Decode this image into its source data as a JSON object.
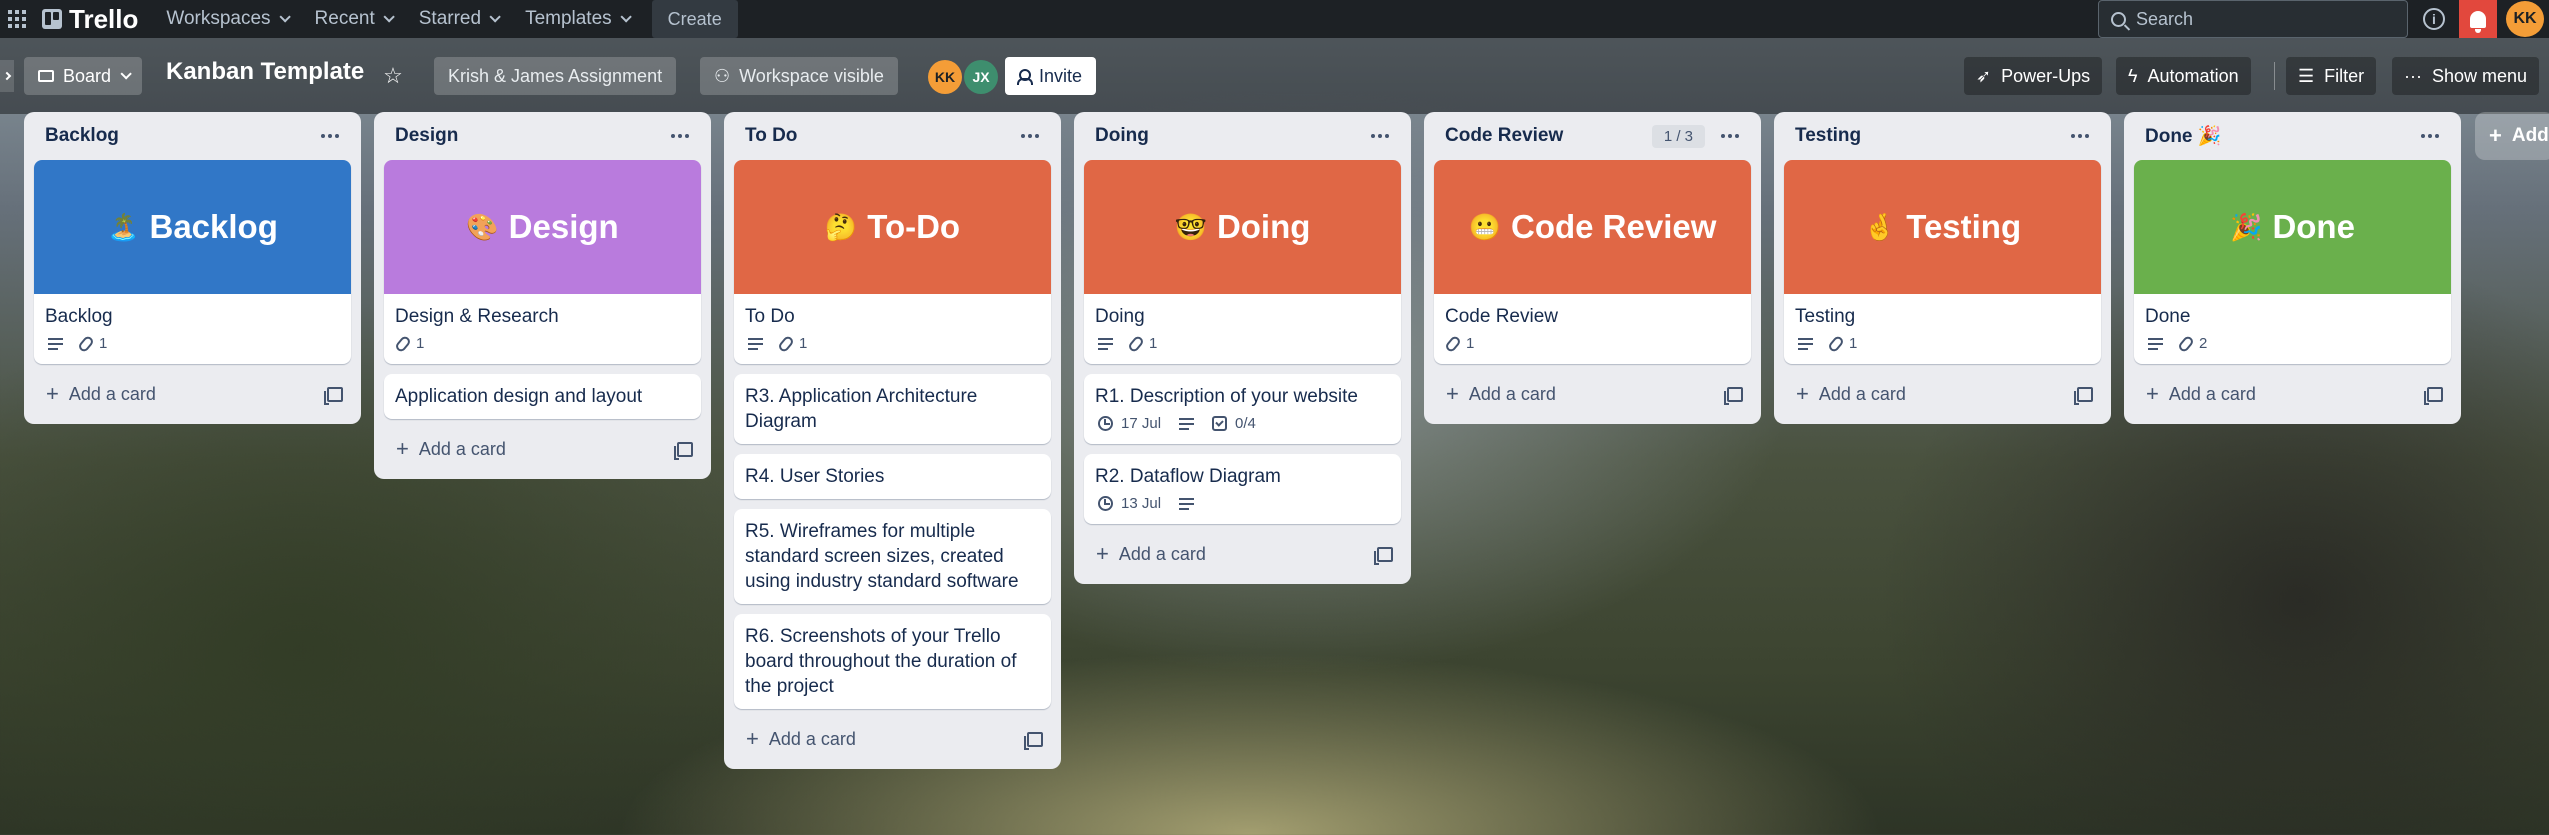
{
  "topnav": {
    "brand": "Trello",
    "menus": [
      "Workspaces",
      "Recent",
      "Starred",
      "Templates"
    ],
    "create_label": "Create",
    "search_placeholder": "Search",
    "avatar_initials": "KK",
    "notification_color": "#e2483d"
  },
  "board": {
    "view_label": "Board",
    "title": "Kanban Template",
    "workspace_label": "Krish & James Assignment",
    "visibility_label": "Workspace visible",
    "members": [
      "KK",
      "JX"
    ],
    "invite_label": "Invite",
    "power_ups_label": "Power-Ups",
    "automation_label": "Automation",
    "filter_label": "Filter",
    "show_menu_label": "Show menu",
    "add_list_label": "Add"
  },
  "lists": [
    {
      "title": "Backlog",
      "cover": {
        "emoji": "🏝️",
        "text": "Backlog",
        "color": "#3177c7"
      },
      "cards": [
        {
          "title": "Backlog",
          "has_description": true,
          "attachments": "1"
        }
      ],
      "add_card": "Add a card"
    },
    {
      "title": "Design",
      "cover": {
        "emoji": "🎨",
        "text": "Design",
        "color": "#b97bdd"
      },
      "cards": [
        {
          "title": "Design & Research",
          "has_description": false,
          "attachments": "1"
        },
        {
          "title": "Application design and layout"
        }
      ],
      "add_card": "Add a card"
    },
    {
      "title": "To Do",
      "cover": {
        "emoji": "🤔",
        "text": "To-Do",
        "color": "#e06745"
      },
      "cards": [
        {
          "title": "To Do",
          "has_description": true,
          "attachments": "1"
        },
        {
          "title": "R3. Application Architecture Diagram"
        },
        {
          "title": "R4. User Stories"
        },
        {
          "title": "R5. Wireframes for multiple standard screen sizes, created using industry standard software"
        },
        {
          "title": "R6. Screenshots of your Trello board throughout the duration of the project"
        }
      ],
      "add_card": "Add a card"
    },
    {
      "title": "Doing",
      "cover": {
        "emoji": "🤓",
        "text": "Doing",
        "color": "#e06745"
      },
      "cards": [
        {
          "title": "Doing",
          "has_description": true,
          "attachments": "1"
        },
        {
          "title": "R1. Description of your website",
          "due": "17 Jul",
          "has_description": true,
          "checklist": "0/4"
        },
        {
          "title": "R2. Dataflow Diagram",
          "due": "13 Jul",
          "has_description": true
        }
      ],
      "add_card": "Add a card"
    },
    {
      "title": "Code Review",
      "counter": "1 / 3",
      "cover": {
        "emoji": "😬",
        "text": "Code Review",
        "color": "#e06745"
      },
      "cards": [
        {
          "title": "Code Review",
          "has_description": false,
          "attachments": "1"
        }
      ],
      "add_card": "Add a card"
    },
    {
      "title": "Testing",
      "cover": {
        "emoji": "🤞",
        "text": "Testing",
        "color": "#e06745"
      },
      "cards": [
        {
          "title": "Testing",
          "has_description": true,
          "attachments": "1"
        }
      ],
      "add_card": "Add a card"
    },
    {
      "title": "Done 🎉",
      "cover": {
        "emoji": "🎉",
        "text": "Done",
        "color": "#6ab04c"
      },
      "cards": [
        {
          "title": "Done",
          "has_description": true,
          "attachments": "2"
        }
      ],
      "add_card": "Add a card"
    }
  ]
}
